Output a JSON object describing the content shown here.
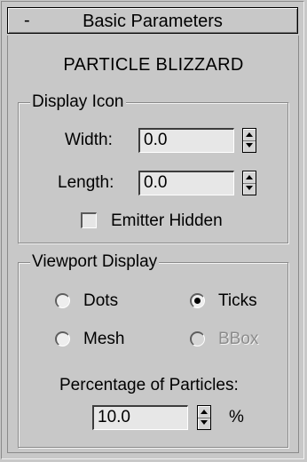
{
  "rollout": {
    "toggle": "-",
    "title": "Basic Parameters"
  },
  "plugin_title": "PARTICLE BLIZZARD",
  "display_icon": {
    "group_label": "Display Icon",
    "width_label": "Width:",
    "width_value": "0.0",
    "length_label": "Length:",
    "length_value": "0.0",
    "emitter_hidden_label": "Emitter Hidden",
    "emitter_hidden_checked": false
  },
  "viewport_display": {
    "group_label": "Viewport Display",
    "options": [
      {
        "label": "Dots",
        "selected": false,
        "enabled": true
      },
      {
        "label": "Ticks",
        "selected": true,
        "enabled": true
      },
      {
        "label": "Mesh",
        "selected": false,
        "enabled": true
      },
      {
        "label": "BBox",
        "selected": false,
        "enabled": false
      }
    ],
    "percentage_label": "Percentage of Particles:",
    "percentage_value": "10.0",
    "percentage_unit": "%"
  }
}
